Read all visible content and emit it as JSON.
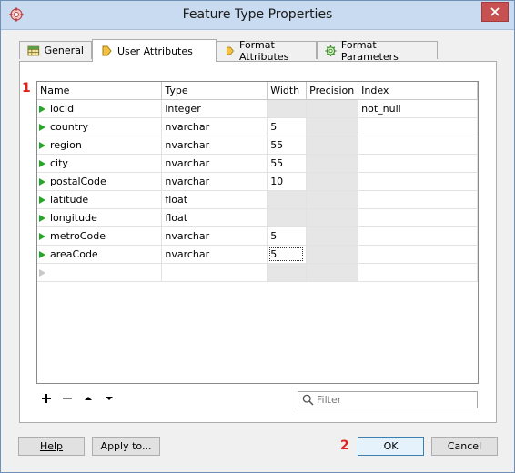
{
  "window": {
    "title": "Feature Type Properties",
    "close_icon": "close-icon",
    "app_icon": "fme-gear-icon"
  },
  "tabs": [
    {
      "label": "General",
      "icon": "grid-table-icon",
      "active": false
    },
    {
      "label": "User Attributes",
      "icon": "diamond-tag-icon",
      "active": true
    },
    {
      "label": "Format Attributes",
      "icon": "diamond-tag-icon",
      "active": false
    },
    {
      "label": "Format Parameters",
      "icon": "gear-icon",
      "active": false
    }
  ],
  "annotations": {
    "marker1": "1",
    "marker2": "2"
  },
  "table": {
    "headers": [
      "Name",
      "Type",
      "Width",
      "Precision",
      "Index"
    ],
    "rows": [
      {
        "name": "locId",
        "type": "integer",
        "width": "",
        "precision": "",
        "index": "not_null"
      },
      {
        "name": "country",
        "type": "nvarchar",
        "width": "5",
        "precision": "",
        "index": ""
      },
      {
        "name": "region",
        "type": "nvarchar",
        "width": "55",
        "precision": "",
        "index": ""
      },
      {
        "name": "city",
        "type": "nvarchar",
        "width": "55",
        "precision": "",
        "index": ""
      },
      {
        "name": "postalCode",
        "type": "nvarchar",
        "width": "10",
        "precision": "",
        "index": ""
      },
      {
        "name": "latitude",
        "type": "float",
        "width": "",
        "precision": "",
        "index": ""
      },
      {
        "name": "longitude",
        "type": "float",
        "width": "",
        "precision": "",
        "index": ""
      },
      {
        "name": "metroCode",
        "type": "nvarchar",
        "width": "5",
        "precision": "",
        "index": ""
      },
      {
        "name": "areaCode",
        "type": "nvarchar",
        "width": "5",
        "precision": "",
        "index": ""
      }
    ]
  },
  "toolbar": {
    "add_icon": "plus-icon",
    "remove_icon": "minus-icon",
    "move_up_icon": "triangle-up-icon",
    "move_down_icon": "triangle-down-icon"
  },
  "filter": {
    "placeholder": "Filter",
    "value": "",
    "icon": "search-icon"
  },
  "buttons": {
    "help": "Help",
    "apply_to": "Apply to...",
    "ok": "OK",
    "cancel": "Cancel"
  }
}
